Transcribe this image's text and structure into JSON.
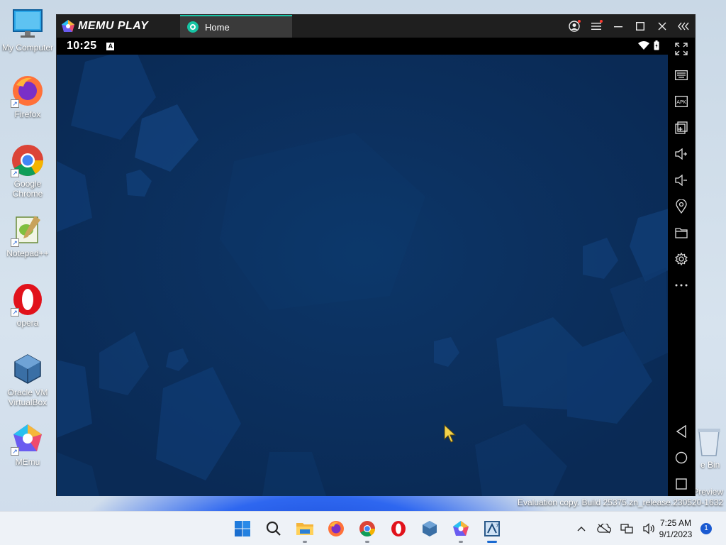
{
  "desktop": {
    "icons": [
      {
        "label": "My Computer",
        "icon": "monitor-icon"
      },
      {
        "label": "Firefox",
        "icon": "firefox-icon"
      },
      {
        "label": "Google Chrome",
        "icon": "chrome-icon"
      },
      {
        "label": "Notepad++",
        "icon": "notepadpp-icon"
      },
      {
        "label": "opera",
        "icon": "opera-icon"
      },
      {
        "label": "Oracle VM VirtualBox",
        "icon": "virtualbox-icon"
      },
      {
        "label": "MEmu",
        "icon": "memu-icon"
      }
    ],
    "recycle_bin_label": "e Bin",
    "watermark_line1": "Preview",
    "watermark_line2": "Evaluation copy. Build 25375.zn_release.230520-1632"
  },
  "memu": {
    "brand": "MEMU PLAY",
    "tab_label": "Home",
    "accent": "#18c6a8",
    "title_controls": [
      "account-icon",
      "menu-icon",
      "minimize-icon",
      "maximize-icon",
      "close-icon",
      "collapse-icon"
    ],
    "android": {
      "time": "10:25",
      "notification_badge": "A"
    },
    "sidebar": [
      "fullscreen-icon",
      "keyboard-icon",
      "apk-icon",
      "multi-instance-icon",
      "volume-up-icon",
      "volume-down-icon",
      "location-icon",
      "folder-icon",
      "settings-icon",
      "more-icon",
      "back-icon",
      "home-icon",
      "recents-icon"
    ]
  },
  "taskbar": {
    "apps": [
      "start-icon",
      "search-icon",
      "file-explorer-icon",
      "firefox-icon",
      "chrome-icon",
      "opera-icon",
      "virtualbox-icon",
      "memu-icon",
      "memu-multi-icon"
    ],
    "time": "7:25 AM",
    "date": "9/1/2023",
    "notification_count": "1"
  }
}
